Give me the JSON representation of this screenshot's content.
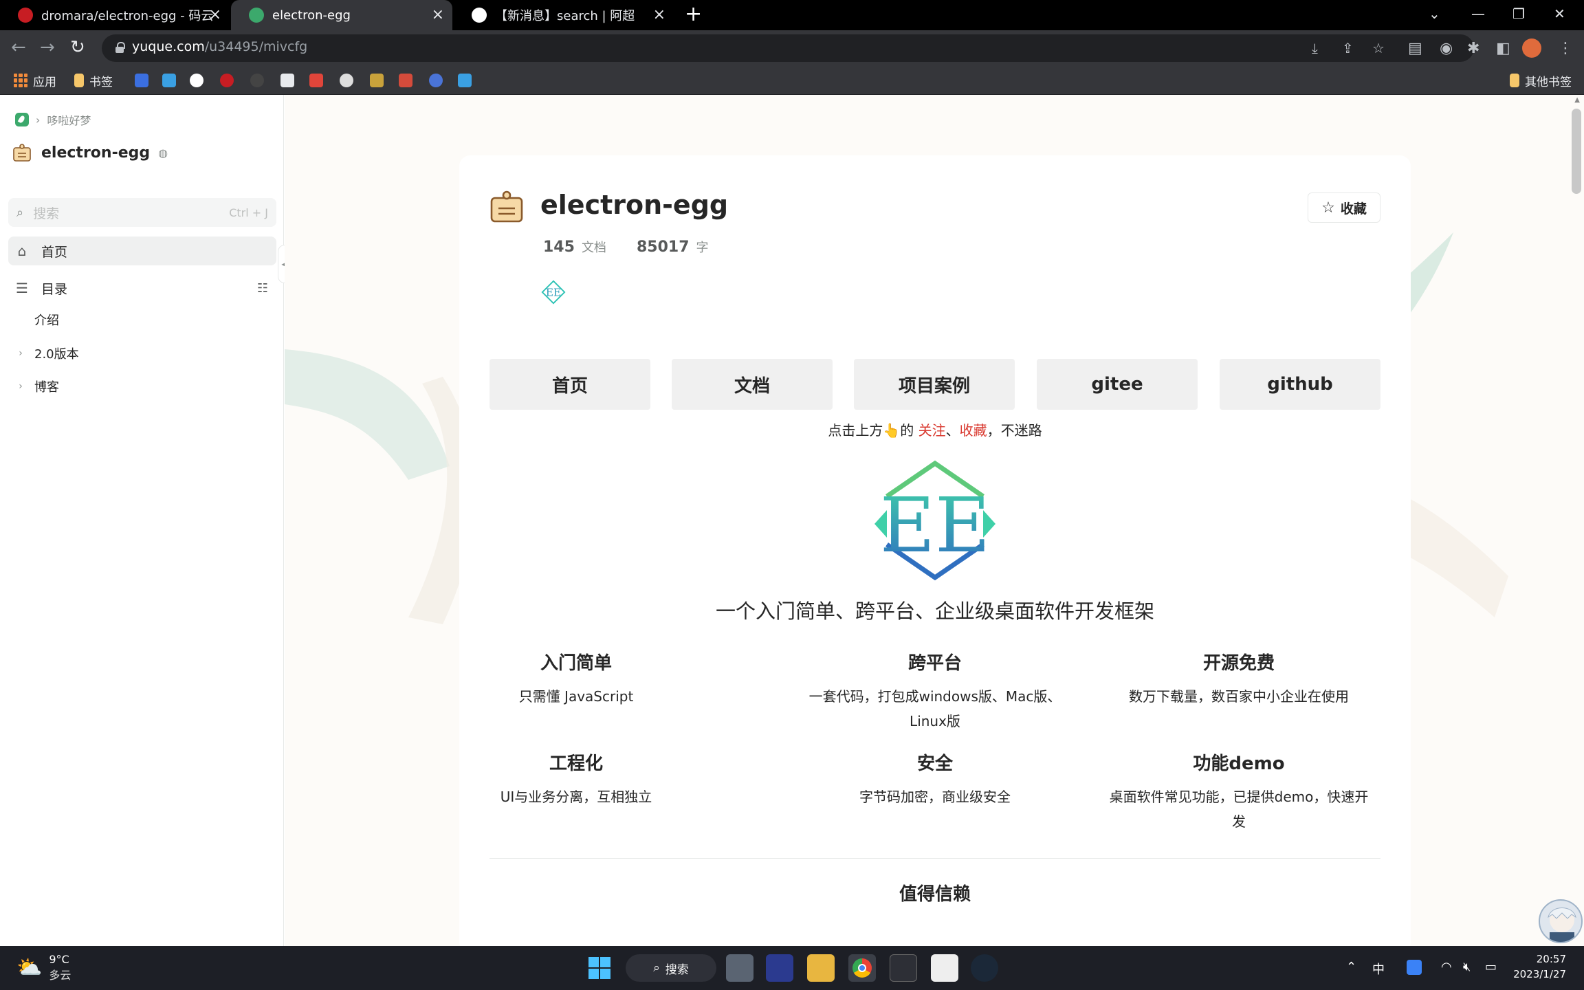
{
  "browser": {
    "tabs": [
      {
        "title": "dromara/electron-egg - 码云 -",
        "active": false
      },
      {
        "title": "electron-egg",
        "active": true
      },
      {
        "title": "【新消息】search | 阿超",
        "active": false
      }
    ],
    "url_host": "yuque.com",
    "url_path": "/u34495/mivcfg",
    "bookmarks": {
      "apps": "应用",
      "bookmarks": "书签",
      "other": "其他书签"
    }
  },
  "sidebar": {
    "breadcrumb": "哆啦好梦",
    "book_name": "electron-egg",
    "search_placeholder": "搜索",
    "search_shortcut": "Ctrl + J",
    "home": "首页",
    "toc_label": "目录",
    "toc": [
      {
        "label": "介绍",
        "expandable": false
      },
      {
        "label": "2.0版本",
        "expandable": true
      },
      {
        "label": "博客",
        "expandable": true
      }
    ]
  },
  "doc": {
    "title": "electron-egg",
    "doc_count": "145",
    "doc_unit": "文档",
    "word_count": "85017",
    "word_unit": "字",
    "favorite_button": "收藏",
    "nav_buttons": [
      "首页",
      "文档",
      "项目案例",
      "gitee",
      "github"
    ],
    "hint_prefix": "点击上方👆的 ",
    "hint_follow": "关注",
    "hint_sep": "、",
    "hint_fav": "收藏",
    "hint_suffix": "，不迷路",
    "tagline": "一个入门简单、跨平台、企业级桌面软件开发框架",
    "features": [
      {
        "title": "入门简单",
        "desc": "只需懂 JavaScript"
      },
      {
        "title": "跨平台",
        "desc": "一套代码，打包成windows版、Mac版、Linux版"
      },
      {
        "title": "开源免费",
        "desc": "数万下载量，数百家中小企业在使用"
      },
      {
        "title": "工程化",
        "desc": "UI与业务分离，互相独立"
      },
      {
        "title": "安全",
        "desc": "字节码加密，商业级安全"
      },
      {
        "title": "功能demo",
        "desc": "桌面软件常见功能，已提供demo，快速开发"
      }
    ],
    "section_title": "值得信赖"
  },
  "taskbar": {
    "temperature": "9°C",
    "weather": "多云",
    "search": "搜索",
    "ime": "中",
    "time": "20:57",
    "date": "2023/1/27"
  },
  "colors": {
    "accent_green": "#3ca96c",
    "hint_red": "#d9392f",
    "ee_teal": "#2cc2b4",
    "ee_blue": "#2f6fc0"
  }
}
